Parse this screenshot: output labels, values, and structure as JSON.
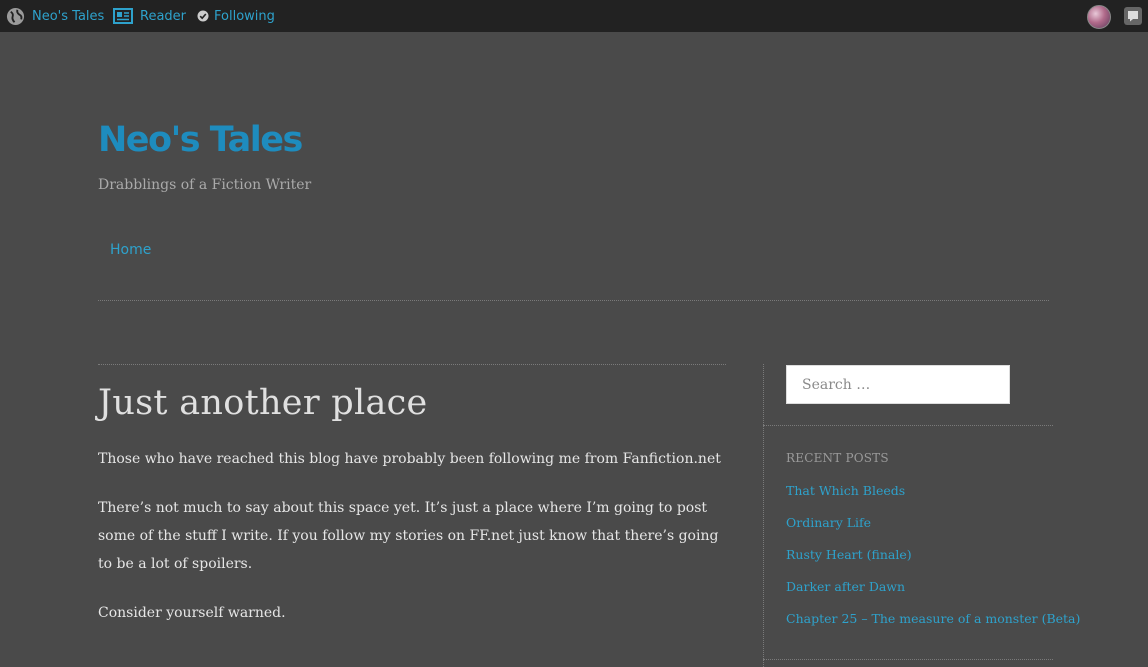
{
  "admin_bar": {
    "site_label": "Neo's Tales",
    "reader_label": "Reader",
    "following_label": "Following",
    "icons": {
      "site": "wordpress-globe-icon",
      "reader": "reader-icon",
      "following": "checkmark-circle-icon",
      "avatar": "user-avatar",
      "notifications": "notifications-icon"
    }
  },
  "header": {
    "site_title": "Neo's Tales",
    "tagline": "Drabblings of a Fiction Writer"
  },
  "nav": {
    "home_label": "Home"
  },
  "post": {
    "title": "Just another place",
    "paragraphs": [
      "Those who have reached this blog have probably been following me from Fanfiction.net",
      "There’s not much to say about this space yet. It’s just a place where I’m going to post some of the stuff I write. If you follow my stories on FF.net just know that there’s going to be a lot of spoilers.",
      "Consider yourself warned."
    ]
  },
  "sidebar": {
    "search_placeholder": "Search …",
    "recent_heading": "RECENT POSTS",
    "recent_posts": [
      "That Which Bleeds",
      "Ordinary Life",
      "Rusty Heart (finale)",
      "Darker after Dawn",
      "Chapter 25 – The measure of a monster (Beta)"
    ]
  },
  "colors": {
    "background": "#4a4a4a",
    "admin_bar": "#222222",
    "link": "#2ea2cc",
    "site_title": "#1e8cbe",
    "text": "#e6e6e6"
  }
}
